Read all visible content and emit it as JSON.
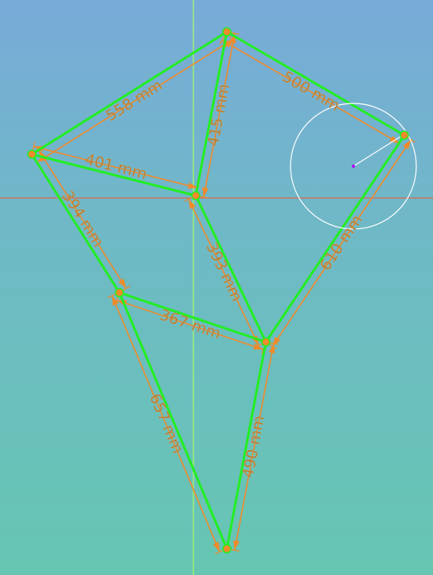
{
  "viewport": {
    "axis_vertical_color": "#9ef07a",
    "axis_horizontal_color": "#d96a52"
  },
  "colors": {
    "edge": "#22ee22",
    "dimension": "#f08a2a",
    "dimension_text": "#c27a2f",
    "circle": "#ffffff",
    "center_point": "#b000ff"
  },
  "nodes": [
    {
      "id": "top"
    },
    {
      "id": "left"
    },
    {
      "id": "right"
    },
    {
      "id": "center"
    },
    {
      "id": "mid-left"
    },
    {
      "id": "mid-right"
    },
    {
      "id": "bottom"
    }
  ],
  "edges": [
    {
      "name": "edge-left-top",
      "label": "558 mm"
    },
    {
      "name": "edge-top-right",
      "label": "500 mm"
    },
    {
      "name": "edge-top-center",
      "label": "415 mm"
    },
    {
      "name": "edge-left-center",
      "label": "401 mm"
    },
    {
      "name": "edge-left-midleft",
      "label": "394 mm"
    },
    {
      "name": "edge-center-midright",
      "label": "393 mm"
    },
    {
      "name": "edge-right-midright",
      "label": "610 mm"
    },
    {
      "name": "edge-midleft-midright",
      "label": "367 mm"
    },
    {
      "name": "edge-midleft-bottom",
      "label": "657 mm"
    },
    {
      "name": "edge-midright-bottom",
      "label": "490 mm"
    }
  ],
  "circle": {
    "name": "selection-circle",
    "center_node": "circle-center"
  }
}
